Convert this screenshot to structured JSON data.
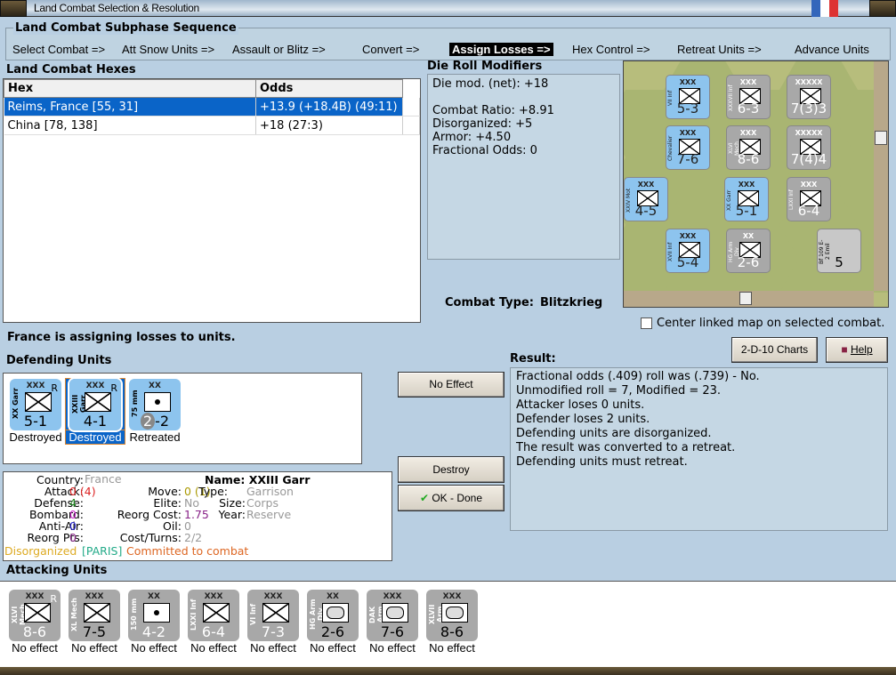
{
  "window": {
    "title": "Land Combat Selection & Resolution"
  },
  "subphase": {
    "title": "Land Combat Subphase Sequence",
    "steps": [
      "Select Combat =>",
      "Att Snow Units =>",
      "Assault or Blitz =>",
      "Convert =>",
      "Assign Losses =>",
      "Hex Control =>",
      "Retreat Units =>",
      "Advance Units"
    ],
    "active_index": 4
  },
  "hexes": {
    "title": "Land Combat Hexes",
    "columns": [
      "Hex",
      "Odds"
    ],
    "rows": [
      {
        "hex": "Reims, France [55, 31]",
        "odds": "+13.9 (+18.4B) (49:11)"
      },
      {
        "hex": "China [78, 138]",
        "odds": "+18 (27:3)"
      }
    ]
  },
  "die_roll": {
    "title": "Die Roll Modifiers",
    "lines": [
      "Die mod. (net): +18",
      "",
      "Combat Ratio: +8.91",
      "Disorganized: +5",
      "Armor: +4.50",
      "Fractional Odds: 0"
    ]
  },
  "combat_type": {
    "label": "Combat Type:",
    "value": "Blitzkrieg"
  },
  "map": {
    "center_checkbox_label": "Center linked map on selected combat.",
    "center_checked": false,
    "counters": [
      {
        "name": "VII Inf",
        "size": "XXX",
        "str": "5-3",
        "side": "blue"
      },
      {
        "name": "XXXVII Inf",
        "size": "XXX",
        "str": "6-3",
        "side": "grey"
      },
      {
        "name": "",
        "size": "XXXXX",
        "str": "7(3)3",
        "side": "grey"
      },
      {
        "name": "Chevalier",
        "size": "XXX",
        "str": "7-6",
        "side": "blue"
      },
      {
        "name": "XLVI Mech",
        "size": "XXX",
        "str": "8-6",
        "side": "grey"
      },
      {
        "name": "",
        "size": "XXXXX",
        "str": "7(4)4",
        "side": "grey"
      },
      {
        "name": "XXIV Mot",
        "size": "XXX",
        "str": "4-5",
        "side": "blue"
      },
      {
        "name": "XX Garr",
        "size": "XXX",
        "str": "5-1",
        "side": "blue"
      },
      {
        "name": "LXXI Inf",
        "size": "XXX",
        "str": "6-4",
        "side": "grey"
      },
      {
        "name": "XVII Inf",
        "size": "XXX",
        "str": "5-4",
        "side": "blue"
      },
      {
        "name": "HG Arm Div",
        "size": "XX",
        "str": "2-6",
        "side": "grey"
      },
      {
        "name": "Bf 109 E-2 Emil",
        "size": "",
        "str": "5",
        "side": "air"
      }
    ]
  },
  "buttons": {
    "charts": "2-D-10 Charts",
    "help": "Help",
    "no_effect": "No Effect",
    "destroy": "Destroy",
    "ok_done": "OK - Done"
  },
  "status": "France is assigning losses to units.",
  "defending": {
    "title": "Defending Units",
    "units": [
      {
        "name": "XX Garr",
        "size": "XXX",
        "reserve": "R",
        "str": "5-1",
        "result": "Destroyed",
        "selected": false
      },
      {
        "name": "XXIII Garr",
        "size": "XXX",
        "reserve": "R",
        "str": "4-1",
        "result": "Destroyed",
        "selected": true
      },
      {
        "name": "75 mm",
        "size": "XX",
        "reserve": "",
        "str_a": "2",
        "str": "-2",
        "result": "Retreated",
        "selected": false
      }
    ]
  },
  "info": {
    "country_k": "Country:",
    "country": "France",
    "attack_k": "Attack:",
    "attack": "0 (4)",
    "defense_k": "Defense:",
    "defense": "4",
    "bombard_k": "Bombard:",
    "bombard": "0",
    "antiair_k": "Anti-Air:",
    "antiair": "0",
    "reorgpts_k": "Reorg Pts:",
    "reorgpts": "0",
    "name": "Name: XXIII Garr",
    "move_k": "Move:",
    "move": "0 (1)",
    "elite_k": "Elite:",
    "elite": "No",
    "reorgcost_k": "Reorg Cost:",
    "reorgcost": "1.75",
    "oil_k": "Oil:",
    "oil": "0",
    "costturns_k": "Cost/Turns:",
    "costturns": "2/2",
    "type_k": "Type:",
    "type": "Garrison",
    "size_k": "Size:",
    "size": "Corps",
    "year_k": "Year:",
    "year": "Reserve",
    "status_disorg": "Disorganized",
    "status_city": "[PARIS]",
    "status_committed": "Committed to combat"
  },
  "result": {
    "title": "Result:",
    "lines": [
      "Fractional odds (.409) roll was (.739)  - No.",
      "Unmodified roll = 7, Modified = 23.",
      "Attacker loses 0 units.",
      "Defender loses 2 units.",
      "Defending units are disorganized.",
      "The result was converted to a retreat.",
      "Defending units must retreat."
    ]
  },
  "attacking": {
    "title": "Attacking Units",
    "units": [
      {
        "name": "XLVI Mech",
        "size": "XXX",
        "reserve": "R",
        "str": "8-6",
        "result": "No effect"
      },
      {
        "name": "XL Mech",
        "size": "XXX",
        "reserve": "",
        "str": "7-5",
        "result": "No effect"
      },
      {
        "name": "150 mm",
        "size": "XX",
        "reserve": "",
        "str": "4-2",
        "result": "No effect"
      },
      {
        "name": "LXXI Inf",
        "size": "XXX",
        "reserve": "",
        "str": "6-4",
        "result": "No effect"
      },
      {
        "name": "VI Inf",
        "size": "XXX",
        "reserve": "",
        "str": "7-3",
        "result": "No effect"
      },
      {
        "name": "HG Arm Div",
        "size": "XX",
        "reserve": "",
        "str": "2-6",
        "result": "No effect"
      },
      {
        "name": "DAK Arm",
        "size": "XXX",
        "reserve": "",
        "str": "7-6",
        "result": "No effect"
      },
      {
        "name": "XLVII Arm",
        "size": "XXX",
        "reserve": "",
        "str": "8-6",
        "result": "No effect"
      }
    ]
  }
}
